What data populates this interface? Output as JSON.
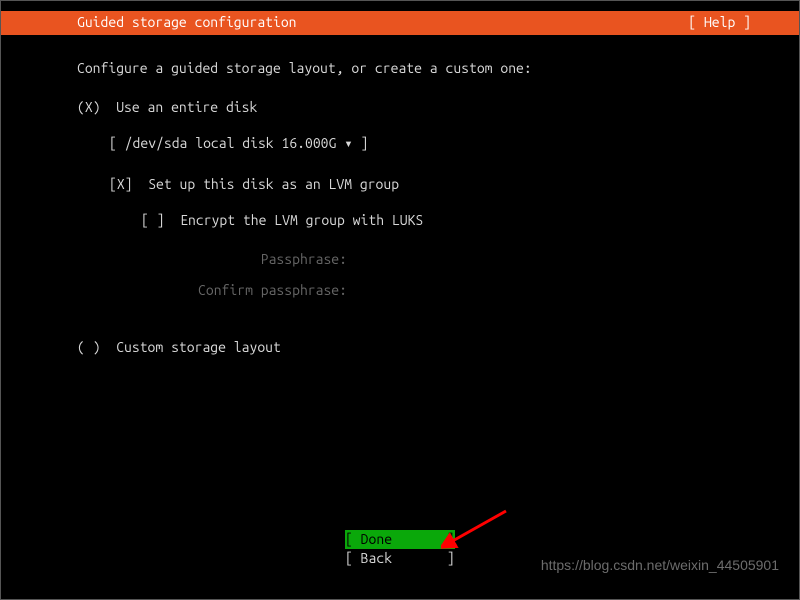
{
  "header": {
    "title": "Guided storage configuration",
    "help": "[ Help ]"
  },
  "instruction": "Configure a guided storage layout, or create a custom one:",
  "guided": {
    "radio": "(X)  Use an entire disk",
    "disk_selector": "[ /dev/sda local disk 16.000G ▾ ]",
    "lvm": "[X]  Set up this disk as an LVM group",
    "luks": "[ ]  Encrypt the LVM group with LUKS",
    "passphrase_label": "Passphrase:",
    "confirm_label": "Confirm passphrase:"
  },
  "custom": {
    "radio": "( )  Custom storage layout"
  },
  "footer": {
    "done": "[ Done       ]",
    "back": "[ Back       ]"
  },
  "watermark": "https://blog.csdn.net/weixin_44505901",
  "colors": {
    "accent": "#e95420",
    "done_bg": "#0aa80a"
  }
}
